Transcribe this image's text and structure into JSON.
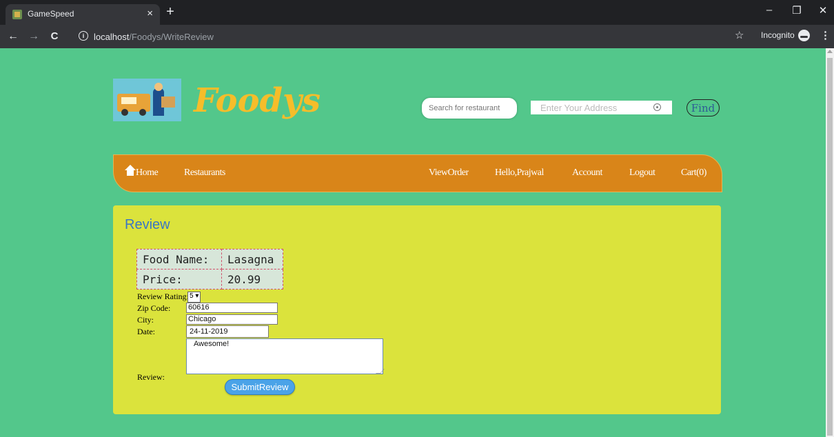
{
  "browser": {
    "tab_title": "GameSpeed",
    "tab_close": "×",
    "new_tab": "+",
    "url_host": "localhost",
    "url_path": "/Foodys/WriteReview",
    "incognito_label": "Incognito",
    "window_controls": {
      "minimize": "–",
      "restore": "❐",
      "close": "✕"
    },
    "nav": {
      "back": "←",
      "forward": "→",
      "reload": "C"
    },
    "star": "☆",
    "menu": "⋮"
  },
  "header": {
    "brand": "Foodys",
    "search_placeholder": "Search for restaurant",
    "address_placeholder": "Enter Your Address",
    "find_label": "Find"
  },
  "nav": {
    "items_left": [
      "Home",
      "Restaurants"
    ],
    "items_right": [
      "ViewOrder",
      "Hello,Prajwal",
      "Account",
      "Logout",
      "Cart(0)"
    ]
  },
  "review": {
    "heading": "Review",
    "table": [
      {
        "label": "Food Name:",
        "value": "Lasagna"
      },
      {
        "label": "Price:",
        "value": "20.99"
      }
    ],
    "rating_label": "Review Rating:",
    "rating_value": "5 ▾",
    "zip_label": "Zip Code:",
    "zip_value": "60616",
    "city_label": "City:",
    "city_value": "Chicago",
    "date_label": "Date:",
    "date_value": "24-11-2019",
    "review_label": "Review:",
    "review_text": "Awesome!",
    "submit_label": "SubmitReview"
  },
  "colors": {
    "page_bg": "#53c78b",
    "brand": "#f6bd2a",
    "navbar": "#d98519",
    "panel": "#dbe33c",
    "heading": "#3a76c4",
    "submit": "#4aa3e8"
  }
}
